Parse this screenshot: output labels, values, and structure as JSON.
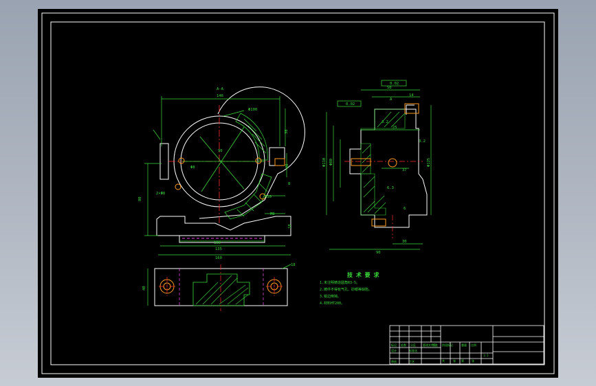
{
  "section_label": "A-A",
  "section_label_right": "A",
  "tech_title": "技 术 要 求",
  "tech_lines": [
    "1.未注明铸造圆角R3-5。",
    "2.铸件不得有气孔、砂眼等缺陷。",
    "3.锐边倒钝。",
    "4.材料HT200。"
  ],
  "dims_left": {
    "top_width": "146",
    "outer_dia": "Φ100",
    "bore_dia": "90",
    "hole_label": "Φ8",
    "height_total": "80",
    "base_w1": "100",
    "base_w2": "135",
    "base_w3": "160",
    "thread": "M8",
    "base_h": "18",
    "r_label": "R10",
    "slot": "8",
    "note_hole": "2×Φ8",
    "small_1": "38",
    "small_2": "20"
  },
  "dims_right": {
    "flatness": "0.02",
    "parallel": "0.02",
    "width_top": "50",
    "width_mid": "25",
    "w14": "14",
    "d110": "Φ110",
    "d80": "Φ80",
    "d125": "Φ125",
    "w30": "30",
    "w90": "90",
    "w6": "6",
    "w37": "37",
    "ra1": "3.2",
    "ra2": "6.3",
    "ra3": "3.2"
  },
  "dims_bottom": {
    "label": "18",
    "height": "40"
  },
  "title_block": {
    "cells": [
      "标记",
      "处数",
      "分区",
      "更改文件号",
      "签名",
      "日期",
      "设计",
      "标准化",
      "审核",
      "工艺",
      "阶段标记",
      "重量",
      "比例",
      "共",
      "张",
      "第",
      "张",
      "1:1"
    ]
  }
}
